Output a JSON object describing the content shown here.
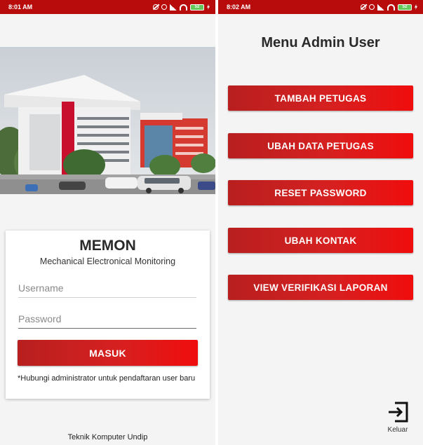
{
  "left_screen": {
    "status_time": "8:01 AM",
    "battery_level": "52",
    "app_title": "MEMON",
    "app_subtitle": "Mechanical Electronical Monitoring",
    "username_placeholder": "Username",
    "password_placeholder": "Password",
    "login_button": "MASUK",
    "register_note": "*Hubungi administrator untuk pendaftaran user baru",
    "footer": "Teknik Komputer Undip",
    "colors": {
      "status_bar": "#b80c0c",
      "button": "#d62020"
    }
  },
  "right_screen": {
    "status_time": "8:02 AM",
    "battery_level": "52",
    "title": "Menu Admin User",
    "menu_items": [
      "TAMBAH PETUGAS",
      "UBAH DATA PETUGAS",
      "RESET PASSWORD",
      "UBAH KONTAK",
      "VIEW VERIFIKASI LAPORAN"
    ],
    "logout_label": "Keluar",
    "logout_icon": "exit-icon"
  }
}
